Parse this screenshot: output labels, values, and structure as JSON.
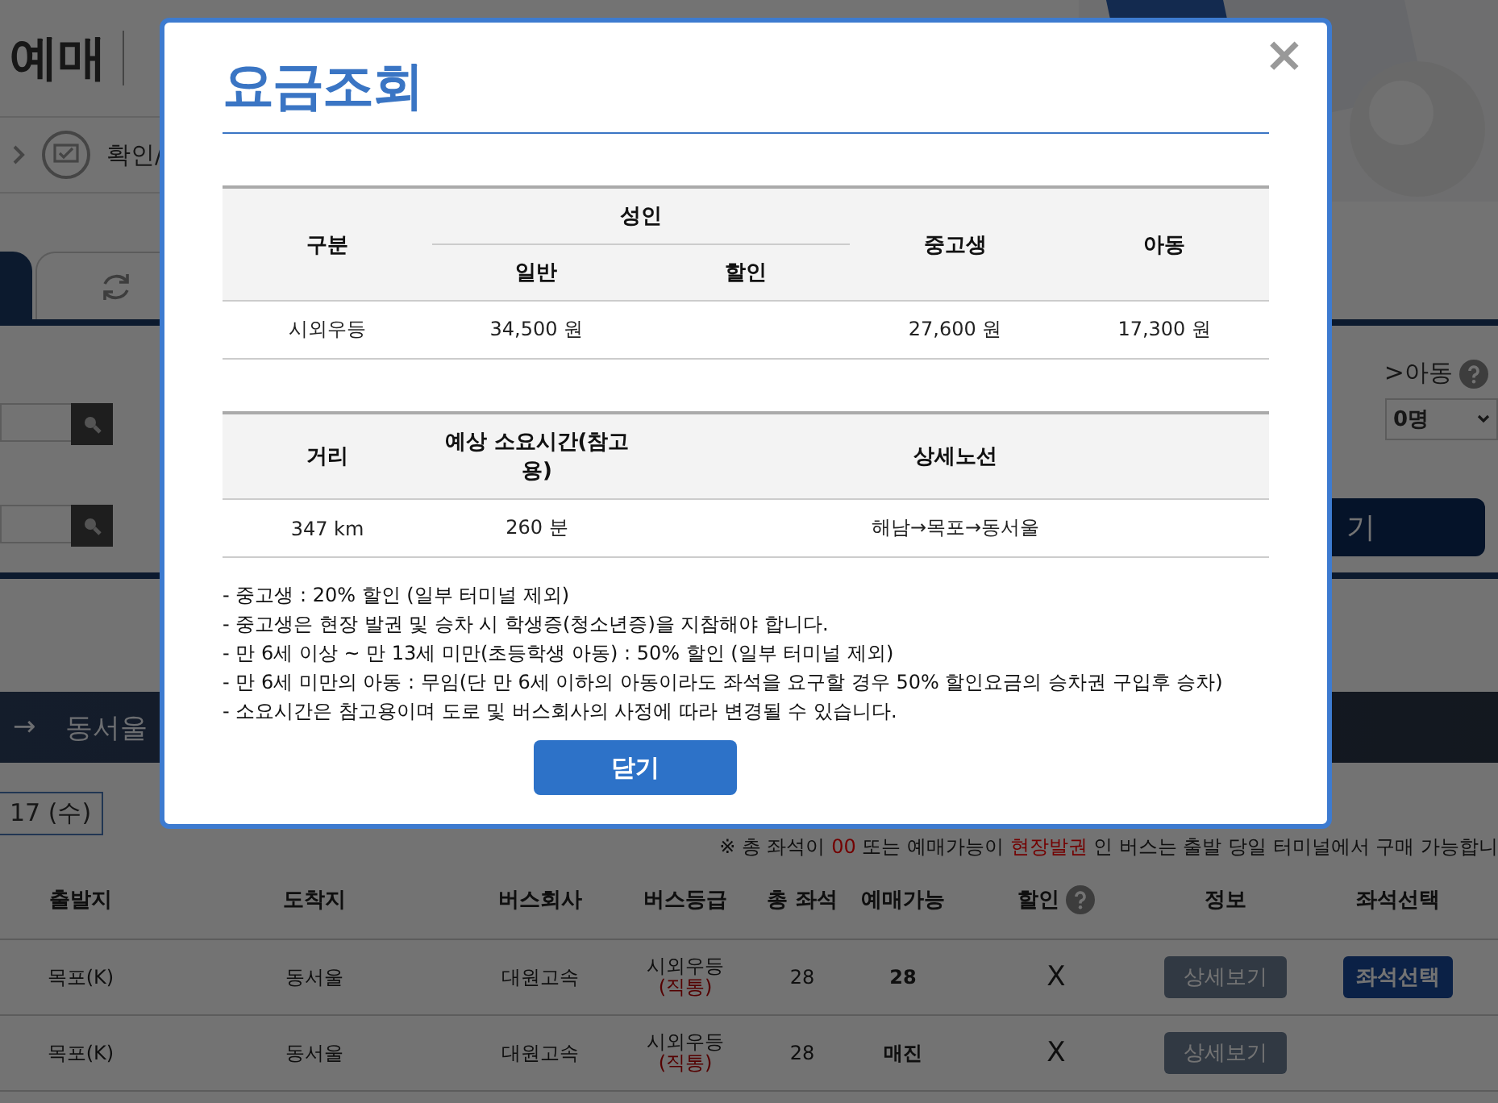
{
  "header": {
    "logo": "예매"
  },
  "breadcrumb": {
    "label": "확인/"
  },
  "form": {
    "child_label": ">아동",
    "child_count": "0명",
    "search_partial": "기"
  },
  "route_bar": {
    "arrow": "→",
    "destination": "동서울"
  },
  "date": "17 (수)",
  "notice": [
    {
      "text": "※ 총 좌석이 ",
      "highlight": false
    },
    {
      "text": "00",
      "highlight": true
    },
    {
      "text": " 또는 예매가능이 ",
      "highlight": false
    },
    {
      "text": "현장발권",
      "highlight": true
    },
    {
      "text": " 인 버스는 출발 당일 터미널에서 구매 가능합니",
      "highlight": false
    }
  ],
  "results": {
    "columns": [
      {
        "label": "출발지",
        "help": false
      },
      {
        "label": "도착지",
        "help": false
      },
      {
        "label": "버스회사",
        "help": false
      },
      {
        "label": "버스등급",
        "help": false
      },
      {
        "label": "총 좌석",
        "help": false
      },
      {
        "label": "예매가능",
        "help": false
      },
      {
        "label": "할인",
        "help": true
      },
      {
        "label": "정보",
        "help": false
      },
      {
        "label": "좌석선택",
        "help": false
      }
    ],
    "rows": [
      {
        "departure": "목포(K)",
        "arrival": "동서울",
        "company": "대원고속",
        "grade": "시외우등",
        "grade_note": "(직통)",
        "total_seats": "28",
        "available": "28",
        "discount": "X",
        "info_button": "상세보기",
        "seat_button": "좌석선택"
      },
      {
        "departure": "목포(K)",
        "arrival": "동서울",
        "company": "대원고속",
        "grade": "시외우등",
        "grade_note": "(직통)",
        "total_seats": "28",
        "available": "매진",
        "discount": "X",
        "info_button": "상세보기"
      }
    ]
  },
  "modal": {
    "title": "요금조회",
    "close": "×",
    "fare_table": {
      "category": "구분",
      "adult": "성인",
      "adult_general": "일반",
      "adult_discount": "할인",
      "student": "중고생",
      "child": "아동",
      "rows": [
        {
          "category": "시외우등",
          "general": "34,500 원",
          "student": "27,600 원",
          "child": "17,300 원"
        }
      ]
    },
    "route_table": {
      "distance": "거리",
      "duration": "예상 소요시간(참고용)",
      "route": "상세노선",
      "rows": [
        {
          "distance": "347 km",
          "duration": "260 분",
          "route": "해남→목포→동서울"
        }
      ]
    },
    "notes": [
      "- 중고생 : 20% 할인 (일부 터미널 제외)",
      "- 중고생은 현장 발권 및 승차 시 학생증(청소년증)을 지참해야 합니다.",
      "- 만 6세 이상 ~ 만 13세 미만(초등학생 아동) : 50% 할인 (일부 터미널 제외)",
      "- 만 6세 미만의 아동 : 무임(단 만 6세 이하의 아동이라도 좌석을 요구할 경우 50% 할인요금의 승차권 구입후 승차)",
      "- 소요시간은 참고용이며 도로 및 버스회사의 사정에 따라 변경될 수 있습니다."
    ],
    "button": "닫기"
  }
}
